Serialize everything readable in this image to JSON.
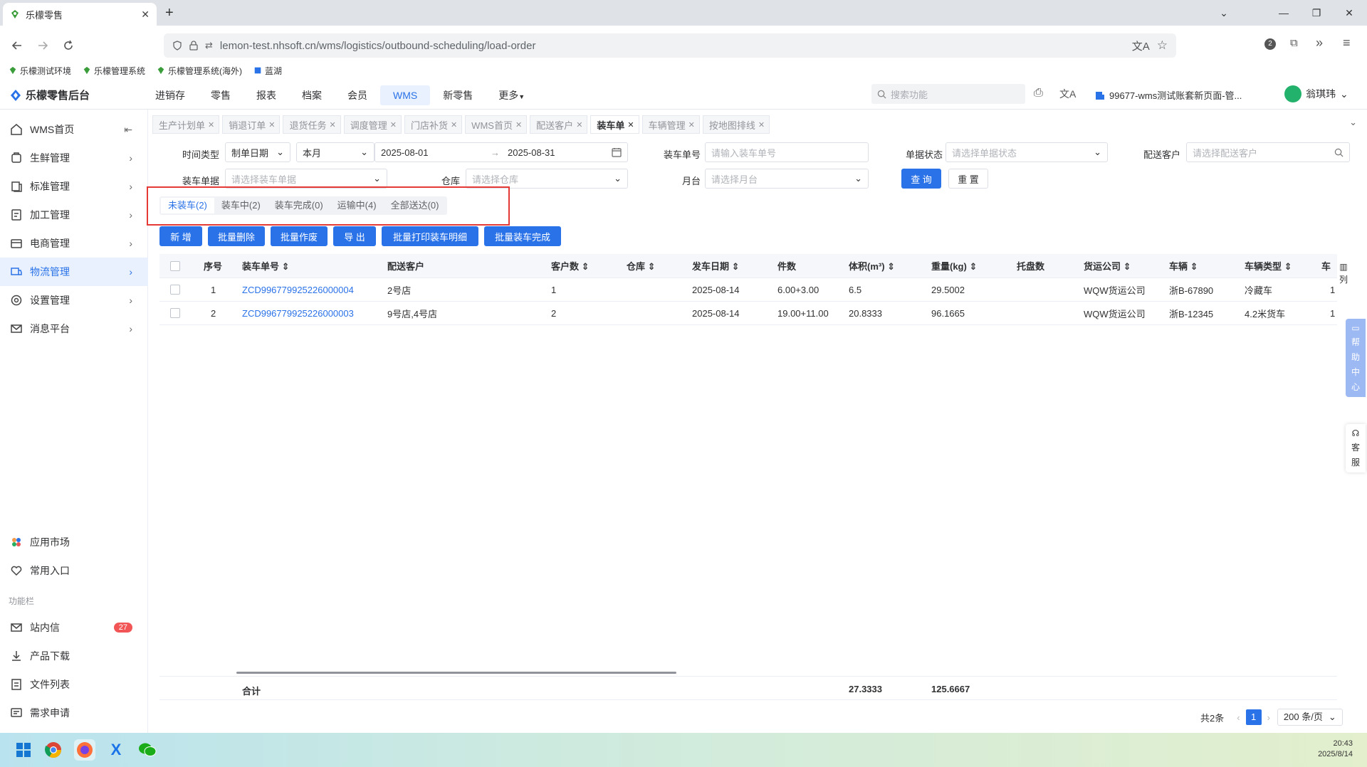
{
  "browser": {
    "tab_title": "乐檬零售",
    "url": "lemon-test.nhsoft.cn/wms/logistics/outbound-scheduling/load-order",
    "bookmarks": [
      "乐檬测试环境",
      "乐檬管理系统",
      "乐檬管理系统(海外)",
      "蓝湖"
    ]
  },
  "app": {
    "logo_text": "乐檬零售后台",
    "top_nav": [
      "进销存",
      "零售",
      "报表",
      "档案",
      "会员",
      "WMS",
      "新零售",
      "更多"
    ],
    "active_top_nav": "WMS",
    "search_placeholder": "搜索功能",
    "account_text": "99677-wms测试账套新页面-管...",
    "user_name": "翁琪玮"
  },
  "sidebar": {
    "items": [
      {
        "label": "WMS首页"
      },
      {
        "label": "生鲜管理"
      },
      {
        "label": "标准管理"
      },
      {
        "label": "加工管理"
      },
      {
        "label": "电商管理"
      },
      {
        "label": "物流管理"
      },
      {
        "label": "设置管理"
      },
      {
        "label": "消息平台"
      }
    ],
    "bottom_items": [
      {
        "label": "应用市场"
      },
      {
        "label": "常用入口"
      }
    ],
    "section_label": "功能栏",
    "func_items": [
      {
        "label": "站内信",
        "badge": "27"
      },
      {
        "label": "产品下载"
      },
      {
        "label": "文件列表"
      },
      {
        "label": "需求申请"
      }
    ]
  },
  "page_tabs": [
    "生产计划单",
    "销退订单",
    "退货任务",
    "调度管理",
    "门店补货",
    "WMS首页",
    "配送客户",
    "装车单",
    "车辆管理",
    "按地图排线"
  ],
  "active_page_tab": "装车单",
  "filters": {
    "time_type_label": "时间类型",
    "time_type_value": "制单日期",
    "period_value": "本月",
    "date_start": "2025-08-01",
    "date_sep": "→",
    "date_end": "2025-08-31",
    "load_no_label": "装车单号",
    "load_no_placeholder": "请输入装车单号",
    "status_label": "单据状态",
    "status_placeholder": "请选择单据状态",
    "customer_label": "配送客户",
    "customer_placeholder": "请选择配送客户",
    "load_doc_label": "装车单据",
    "load_doc_placeholder": "请选择装车单据",
    "warehouse_label": "仓库",
    "warehouse_placeholder": "请选择仓库",
    "platform_label": "月台",
    "platform_placeholder": "请选择月台",
    "query_btn": "查 询",
    "reset_btn": "重 置"
  },
  "status_tabs": [
    "未装车(2)",
    "装车中(2)",
    "装车完成(0)",
    "运输中(4)",
    "全部送达(0)"
  ],
  "actions": [
    "新 增",
    "批量删除",
    "批量作废",
    "导 出",
    "批量打印装车明细",
    "批量装车完成"
  ],
  "table": {
    "columns": [
      "序号",
      "装车单号",
      "配送客户",
      "客户数",
      "仓库",
      "发车日期",
      "件数",
      "体积(m³)",
      "重量(kg)",
      "托盘数",
      "货运公司",
      "车辆",
      "车辆类型",
      "车"
    ],
    "rows": [
      {
        "idx": "1",
        "no": "ZCD996779925226000004",
        "customer": "2号店",
        "count": "1",
        "warehouse": "",
        "date": "2025-08-14",
        "pieces": "6.00+3.00",
        "volume": "6.5",
        "weight": "29.5002",
        "pallets": "",
        "carrier": "WQW货运公司",
        "vehicle": "浙B-67890",
        "vtype": "冷藏车",
        "extra": "1"
      },
      {
        "idx": "2",
        "no": "ZCD996779925226000003",
        "customer": "9号店,4号店",
        "count": "2",
        "warehouse": "",
        "date": "2025-08-14",
        "pieces": "19.00+11.00",
        "volume": "20.8333",
        "weight": "96.1665",
        "pallets": "",
        "carrier": "WQW货运公司",
        "vehicle": "浙B-12345",
        "vtype": "4.2米货车",
        "extra": "1"
      }
    ],
    "summary_label": "合计",
    "summary_volume": "27.3333",
    "summary_weight": "125.6667",
    "column_setting": "列"
  },
  "pager": {
    "total": "共2条",
    "current": "1",
    "page_size": "200 条/页"
  },
  "float": {
    "help": [
      "帮",
      "助",
      "中",
      "心"
    ],
    "service": [
      "客",
      "服"
    ]
  },
  "taskbar": {
    "time": "20:43",
    "date": "2025/8/14"
  }
}
